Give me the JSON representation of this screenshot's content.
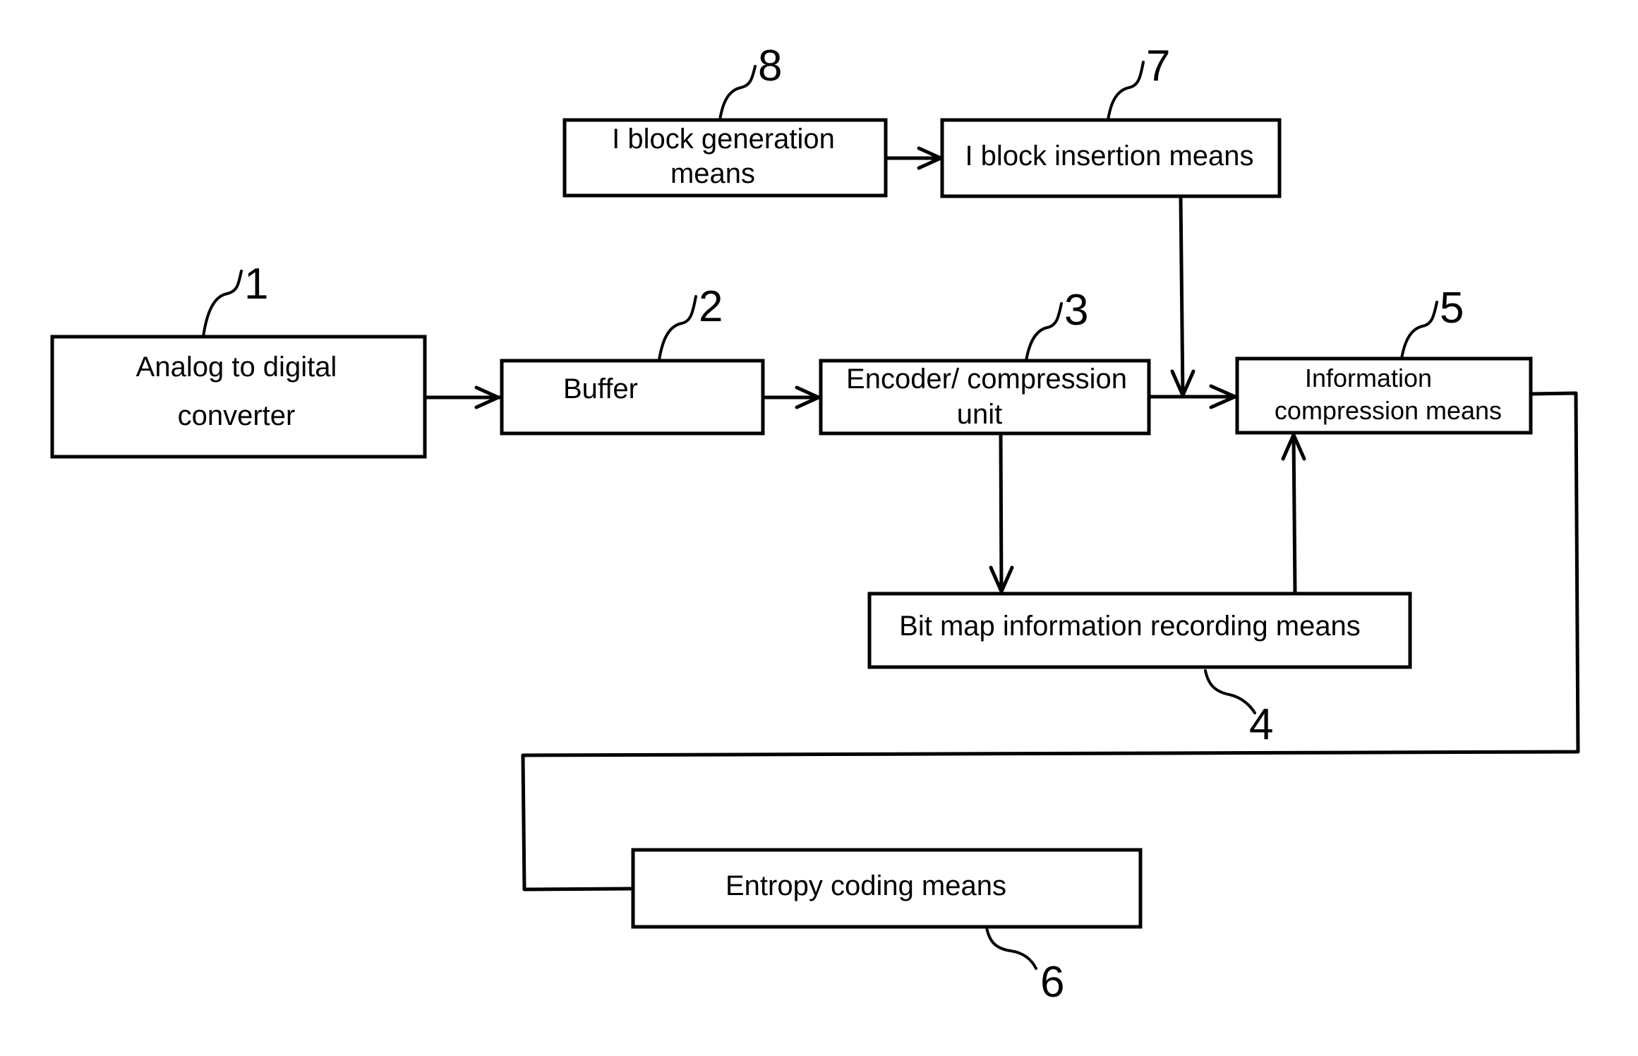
{
  "figure": {
    "blocks": [
      {
        "id": "1",
        "ref": "1",
        "lines": [
          "Analog to digital",
          "converter"
        ]
      },
      {
        "id": "2",
        "ref": "2",
        "lines": [
          "Buffer"
        ]
      },
      {
        "id": "3",
        "ref": "3",
        "lines": [
          "Encoder/ compression",
          "unit"
        ]
      },
      {
        "id": "4",
        "ref": "4",
        "lines": [
          "Bit map information recording means"
        ]
      },
      {
        "id": "5",
        "ref": "5",
        "lines": [
          "Information",
          "compression means"
        ]
      },
      {
        "id": "6",
        "ref": "6",
        "lines": [
          "Entropy coding means"
        ]
      },
      {
        "id": "7",
        "ref": "7",
        "lines": [
          "I block insertion means"
        ]
      },
      {
        "id": "8",
        "ref": "8",
        "lines": [
          "I block generation",
          "means"
        ]
      }
    ],
    "connections": [
      {
        "from": "1",
        "to": "2"
      },
      {
        "from": "2",
        "to": "3"
      },
      {
        "from": "3",
        "to": "5"
      },
      {
        "from": "8",
        "to": "7"
      },
      {
        "from": "7",
        "to": "5"
      },
      {
        "from": "3",
        "to": "4"
      },
      {
        "from": "4",
        "to": "5"
      },
      {
        "from": "5",
        "to": "6"
      }
    ]
  }
}
